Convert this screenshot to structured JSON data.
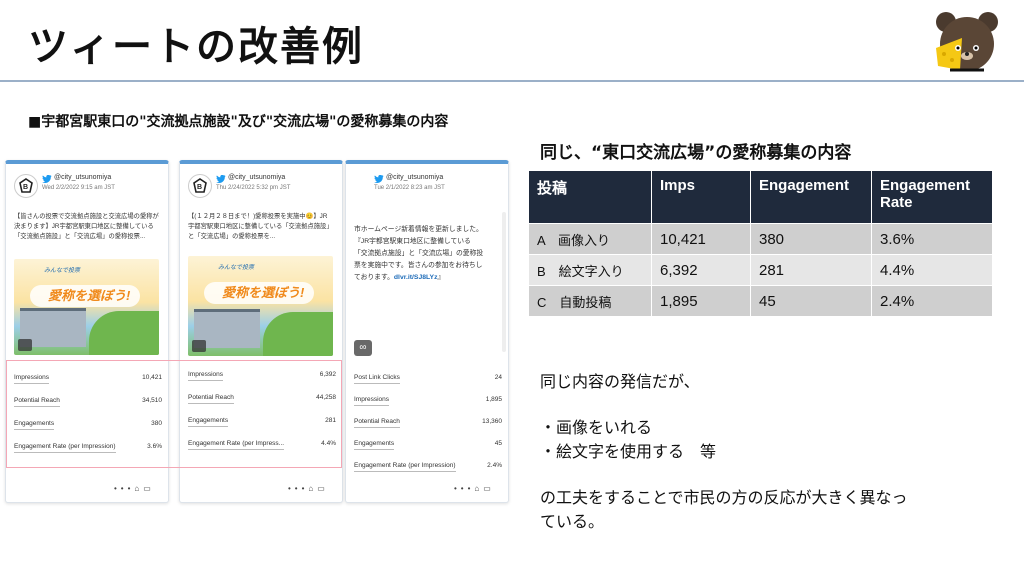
{
  "slide": {
    "title": "ツィートの改善例",
    "subtitle": "■宇都宮駅東口の\"交流拠点施設\"及び\"交流広場\"の愛称募集の内容"
  },
  "tweets": [
    {
      "handle": "@city_utsunomiya",
      "date": "Wed 2/2/2022 9:15 am JST",
      "text": "【皆さんの投票で交流拠点施設と交流広場の愛称が決まります】JR宇都宮駅東口地区に整備している「交流拠点施設」と「交流広場」の愛称投票...",
      "image_line1": "みんなで投票",
      "image_line2": "愛称を選ぼう!",
      "stats": [
        {
          "label": "Impressions",
          "value": "10,421"
        },
        {
          "label": "Potential Reach",
          "value": "34,510"
        },
        {
          "label": "Engagements",
          "value": "380"
        },
        {
          "label": "Engagement Rate (per Impression)",
          "value": "3.6%"
        }
      ]
    },
    {
      "handle": "@city_utsunomiya",
      "date": "Thu 2/24/2022 5:32 pm JST",
      "text": "【(１２月２８日まで！)愛称投票を実施中😊】JR宇都宮駅東口地区に整備している「交流拠点施設」と「交流広場」の愛称投票を...",
      "image_line1": "みんなで投票",
      "image_line2": "愛称を選ぼう!",
      "stats": [
        {
          "label": "Impressions",
          "value": "6,392"
        },
        {
          "label": "Potential Reach",
          "value": "44,258"
        },
        {
          "label": "Engagements",
          "value": "281"
        },
        {
          "label": "Engagement Rate (per Impress...",
          "value": "4.4%"
        }
      ]
    },
    {
      "handle": "@city_utsunomiya",
      "date": "Tue 2/1/2022 8:23 am JST",
      "text": "市ホームページ新着情報を更新しました。『JR宇都宮駅東口地区に整備している「交流拠点施設」と「交流広場」の愛称投票を実施中です。皆さんの参加をお待ちしております。",
      "link": "dlvr.it/SJ8LYz",
      "text_end": "』",
      "stats": [
        {
          "label": "Post Link Clicks",
          "value": "24"
        },
        {
          "label": "Impressions",
          "value": "1,895"
        },
        {
          "label": "Potential Reach",
          "value": "13,360"
        },
        {
          "label": "Engagements",
          "value": "45"
        },
        {
          "label": "Engagement Rate (per Impression)",
          "value": "2.4%"
        }
      ]
    }
  ],
  "table": {
    "caption": "同じ、“東口交流広場”の愛称募集の内容",
    "headers": [
      "投稿",
      "Imps",
      "Engagement",
      "Engagement Rate"
    ],
    "rows": [
      {
        "label": "A　画像入り",
        "imps": "10,421",
        "engagement": "380",
        "rate": "3.6%"
      },
      {
        "label": "B　絵文字入り",
        "imps": "6,392",
        "engagement": "281",
        "rate": "4.4%"
      },
      {
        "label": "C　自動投稿",
        "imps": "1,895",
        "engagement": "45",
        "rate": "2.4%"
      }
    ]
  },
  "notes": {
    "line1": "同じ内容の発信だが、",
    "line2": "・画像をいれる",
    "line3": "・絵文字を使用する　等",
    "line4": "の工夫をすることで市民の方の反応が大きく異なっ",
    "line5": "ている。"
  },
  "icons": [
    "twitter-bird-icon",
    "image-icon",
    "link-icon",
    "more-icon",
    "tag-icon",
    "reply-icon",
    "mascot-bear-icon"
  ]
}
